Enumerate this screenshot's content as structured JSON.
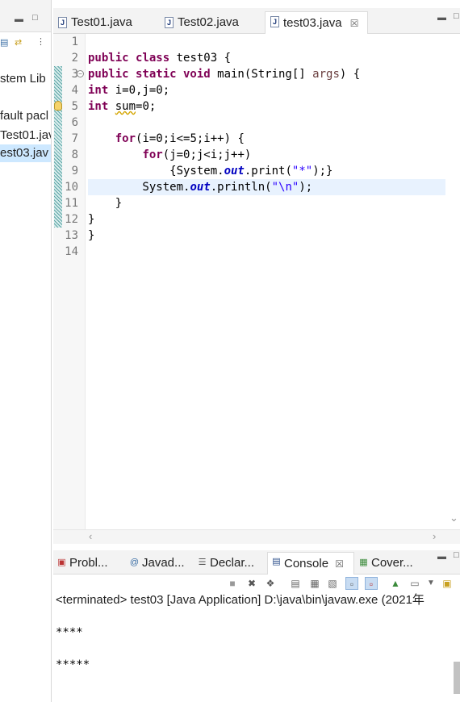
{
  "package_explorer": {
    "items": [
      {
        "label": "stem Lib"
      },
      {
        "label": "fault pacl"
      },
      {
        "label": "Test01.jav"
      },
      {
        "label": "est03.jav"
      }
    ]
  },
  "editor": {
    "tabs": [
      {
        "label": "Test01.java"
      },
      {
        "label": "Test02.java"
      },
      {
        "label": "test03.java",
        "close": "☒"
      }
    ],
    "line_numbers": [
      "1",
      "2",
      "3",
      "4",
      "5",
      "6",
      "7",
      "8",
      "9",
      "10",
      "11",
      "12",
      "13",
      "14"
    ],
    "code": {
      "l2_kw": "public class",
      "l2_rest": " test03 {",
      "l3_kw1": "public static void",
      "l3_mid": " main(String[] ",
      "l3_param": "args",
      "l3_end": ") {",
      "l4_kw": "int",
      "l4_rest": " i=0,j=0;",
      "l5_kw": "int",
      "l5_sp": " ",
      "l5_var": "sum",
      "l5_rest": "=0;",
      "l7_indent": "    ",
      "l7_kw": "for",
      "l7_rest": "(i=0;i<=5;i++) {",
      "l8_indent": "        ",
      "l8_kw": "for",
      "l8_rest": "(j=0;j<i;j++)",
      "l9_a": "            {System.",
      "l9_fld": "out",
      "l9_b": ".print(",
      "l9_str": "\"*\"",
      "l9_c": ");}",
      "l10_a": "        System.",
      "l10_fld": "out",
      "l10_b": ".println(",
      "l10_str": "\"\\n\"",
      "l10_c": ");",
      "l11": "    }",
      "l12": "}",
      "l13": "}"
    }
  },
  "bottom": {
    "tabs": [
      {
        "label": "Probl...",
        "icon": "▣"
      },
      {
        "label": "Javad...",
        "icon": "@"
      },
      {
        "label": "Declar...",
        "icon": "☰"
      },
      {
        "label": "Console",
        "icon": "▤",
        "close": "☒"
      },
      {
        "label": "Cover...",
        "icon": "▦"
      }
    ],
    "console_status": "<terminated> test03 [Java Application] D:\\java\\bin\\javaw.exe  (2021年",
    "output_lines": [
      "****",
      "*****"
    ]
  },
  "colors": {
    "keyword": "#7f0055",
    "static_field": "#0000c0",
    "string": "#2a00ff",
    "parameter": "#6a3e3e",
    "current_line": "#e8f2fe"
  }
}
